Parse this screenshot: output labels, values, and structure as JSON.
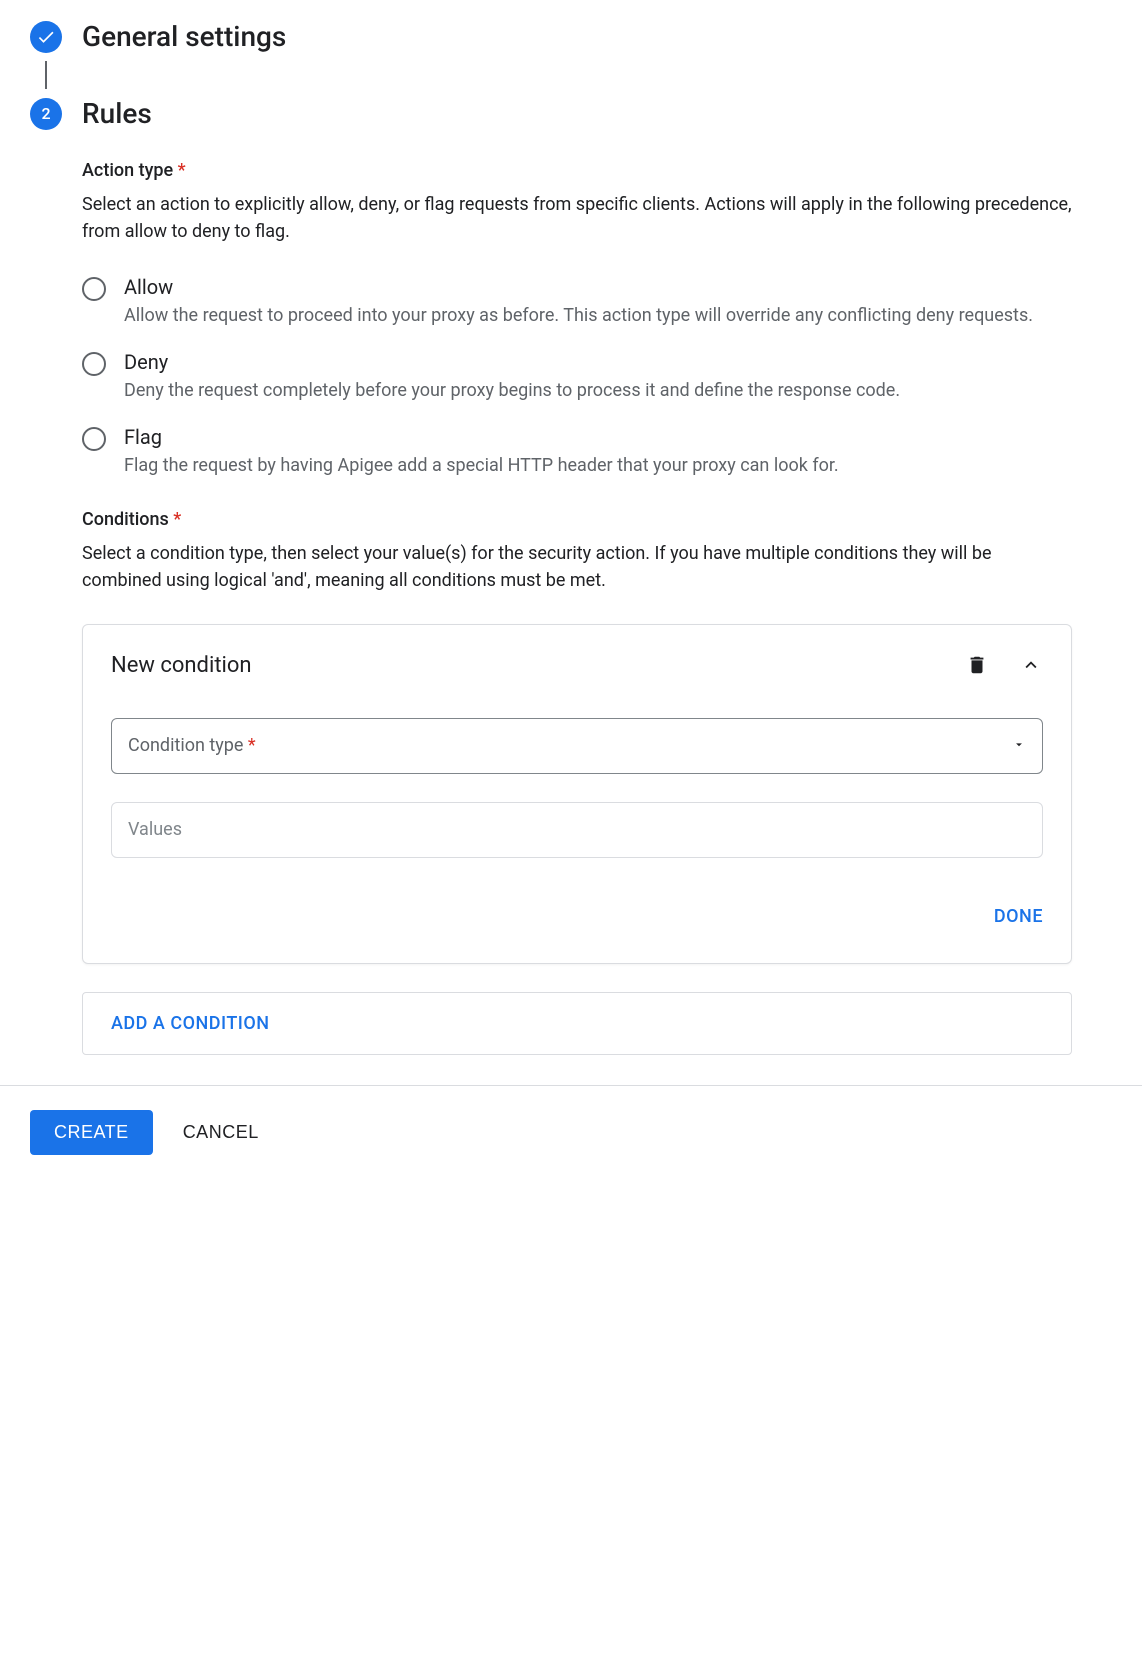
{
  "steps": {
    "general": {
      "title": "General settings"
    },
    "rules": {
      "number": "2",
      "title": "Rules"
    }
  },
  "action_type": {
    "label": "Action type",
    "required_mark": "*",
    "description": "Select an action to explicitly allow, deny, or flag requests from specific clients. Actions will apply in the following precedence, from allow to deny to flag.",
    "options": [
      {
        "label": "Allow",
        "desc": "Allow the request to proceed into your proxy as before. This action type will override any conflicting deny requests."
      },
      {
        "label": "Deny",
        "desc": "Deny the request completely before your proxy begins to process it and define the response code."
      },
      {
        "label": "Flag",
        "desc": "Flag the request by having Apigee add a special HTTP header that your proxy can look for."
      }
    ]
  },
  "conditions": {
    "label": "Conditions",
    "required_mark": "*",
    "description": "Select a condition type, then select your value(s) for the security action. If you have multiple conditions they will be combined using logical 'and', meaning all conditions must be met.",
    "card": {
      "title": "New condition",
      "type_label": "Condition type",
      "type_required": "*",
      "values_placeholder": "Values",
      "done_label": "DONE"
    },
    "add_label": "ADD A CONDITION"
  },
  "footer": {
    "create": "CREATE",
    "cancel": "CANCEL"
  }
}
